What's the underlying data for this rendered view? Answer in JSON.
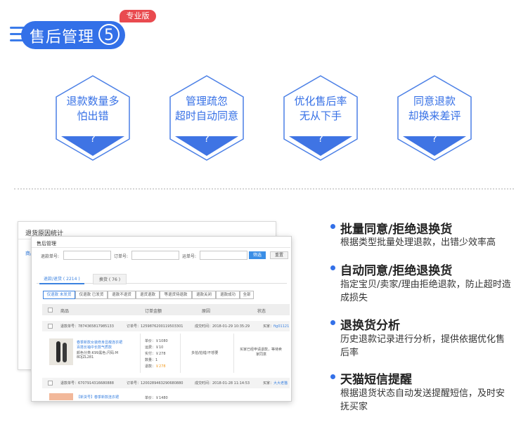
{
  "header": {
    "title": "售后管理",
    "number": "5",
    "badge": "专业版"
  },
  "hexagons": [
    {
      "line1": "退款数量多",
      "line2": "怕出错",
      "mark": "?"
    },
    {
      "line1": "管理疏忽",
      "line2": "超时自动同意",
      "mark": "?"
    },
    {
      "line1": "优化售后率",
      "line2": "无从下手",
      "mark": "?"
    },
    {
      "line1": "同意退款",
      "line2": "却换来差评",
      "mark": "?"
    }
  ],
  "colors": {
    "accent": "#3370e8",
    "badge": "#e94a4f",
    "link": "#3b82e0",
    "price": "#f39a1e"
  },
  "screenshot": {
    "back_title": "退货原因统计",
    "back_left_label": "商品",
    "front_title": "售后管理",
    "search": {
      "refund_no": "退款单号:",
      "order_no": "订单号:",
      "waybill_no": "运单号:",
      "filter_btn": "筛选",
      "reset_btn": "重置"
    },
    "tabs": [
      "退款/退货 ( 2214 )",
      "换货 ( 76 )"
    ],
    "chips": [
      "仅退款 未发货",
      "仅退款 已发货",
      "退款不退货",
      "退货退款",
      "等退货待退款",
      "退款关闭",
      "退款成功",
      "全部"
    ],
    "columns": [
      "商品",
      "订单金额",
      "原因",
      "状态"
    ],
    "row1": {
      "refund_label": "退款单号：7874365817985133",
      "order_label": "订单号：1259876200119503301",
      "time_label": "成交时间：2018-01-29 10:35:29",
      "buyer_label": "买家：",
      "buyer_name": "fig01121",
      "item_title": "春季新款女装修身显瘦连衣裙",
      "item_title2": "百搭长袖中长款气质款",
      "item_spec": "颜色分类:K99黑色;尺码:M",
      "item_code": "8DJZL281",
      "price_unit": "单价：￥1080",
      "price_ship": "运费：￥10",
      "price_paid": "实付：￥278",
      "qty": "数量：1",
      "refund_amt_label": "退款：",
      "refund_amt": "￥278",
      "reason": "多拍/拍错/不想要",
      "status1": "买家已经申请退款，等待卖",
      "status2": "家同意"
    },
    "row2": {
      "refund_label": "退款单号：6707914316680888",
      "order_label": "订单号：1200289463290680880",
      "time_label": "成交时间：2018-01-28 11:14:53",
      "buyer_label": "买家：",
      "buyer_name": "大大老猫",
      "item_title": "【新货号】春季新款连衣裙",
      "price_unit": "单价：￥1480"
    }
  },
  "features": [
    {
      "title": "批量同意/拒绝退换货",
      "desc": "根据类型批量处理退款，出错少效率高"
    },
    {
      "title": "自动同意/拒绝退换货",
      "desc": "指定宝贝/卖家/理由拒绝退款，防止超时造成损失"
    },
    {
      "title": "退换货分析",
      "desc": "历史退款记录进行分析，提供依据优化售后率"
    },
    {
      "title": "天猫短信提醒",
      "desc": "根据退货状态自动发送提醒短信，及时安抚买家"
    }
  ]
}
